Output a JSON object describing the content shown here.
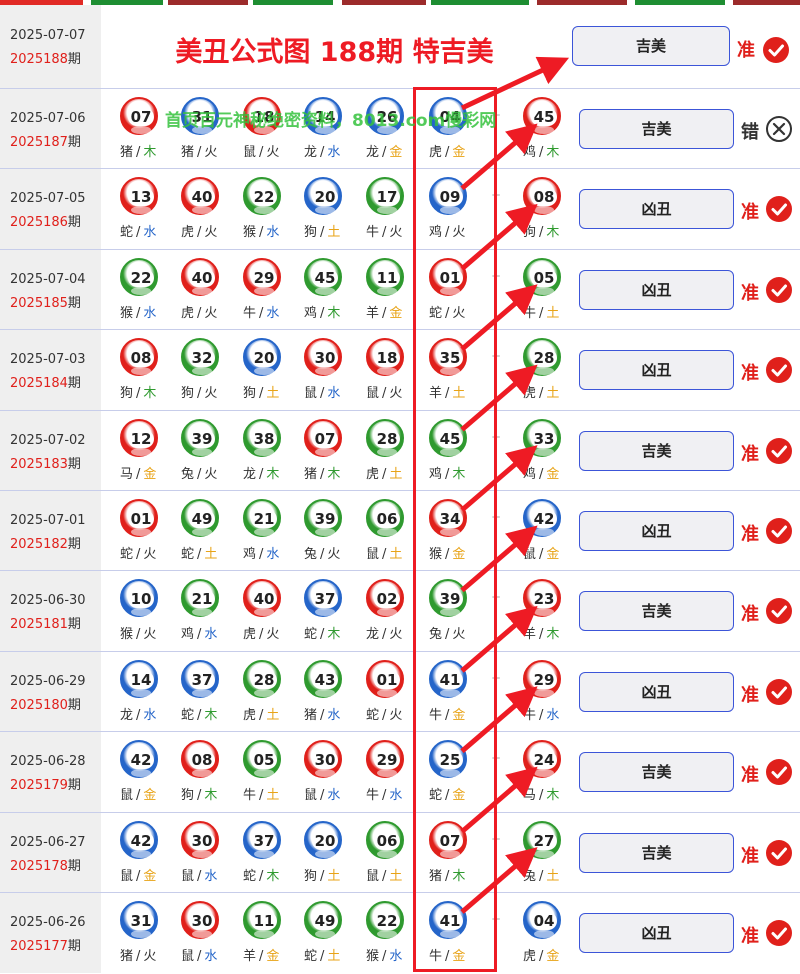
{
  "header": {
    "title": "美丑公式图 188期 特吉美",
    "result": "吉美",
    "verdict": "准"
  },
  "watermark": "首页百元神秘绝密资料，8013.com慢彩网",
  "top_stripe_colors": [
    "#e12a25",
    "#1e8e32",
    "#9c2b2b",
    "#1e8e32",
    "#9c2b2b",
    "#1e8e32",
    "#9c2b2b",
    "#1e8e32",
    "#9c2b2b",
    "#1e8e32",
    "#2a4ad6"
  ],
  "latest": {
    "date": "2025-07-07",
    "issue": "2025188",
    "suffix": "期"
  },
  "rows": [
    {
      "date": "2025-07-06",
      "issue": "2025187",
      "suffix": "期",
      "balls": [
        {
          "n": "07",
          "c": "red",
          "z": "猪",
          "e": "木"
        },
        {
          "n": "31",
          "c": "blue",
          "z": "猪",
          "e": "火"
        },
        {
          "n": "18",
          "c": "red",
          "z": "鼠",
          "e": "火"
        },
        {
          "n": "14",
          "c": "blue",
          "z": "龙",
          "e": "水"
        },
        {
          "n": "26",
          "c": "blue",
          "z": "龙",
          "e": "金"
        },
        {
          "n": "04",
          "c": "blue",
          "z": "虎",
          "e": "金"
        },
        {
          "n": "45",
          "c": "red",
          "z": "鸡",
          "e": "木"
        }
      ],
      "result": "吉美",
      "verdict": "错",
      "ok": false
    },
    {
      "date": "2025-07-05",
      "issue": "2025186",
      "suffix": "期",
      "balls": [
        {
          "n": "13",
          "c": "red",
          "z": "蛇",
          "e": "水"
        },
        {
          "n": "40",
          "c": "red",
          "z": "虎",
          "e": "火"
        },
        {
          "n": "22",
          "c": "green",
          "z": "猴",
          "e": "水"
        },
        {
          "n": "20",
          "c": "blue",
          "z": "狗",
          "e": "土"
        },
        {
          "n": "17",
          "c": "green",
          "z": "牛",
          "e": "火"
        },
        {
          "n": "09",
          "c": "blue",
          "z": "鸡",
          "e": "火"
        },
        {
          "n": "08",
          "c": "red",
          "z": "狗",
          "e": "木"
        }
      ],
      "result": "凶丑",
      "verdict": "准",
      "ok": true
    },
    {
      "date": "2025-07-04",
      "issue": "2025185",
      "suffix": "期",
      "balls": [
        {
          "n": "22",
          "c": "green",
          "z": "猴",
          "e": "水"
        },
        {
          "n": "40",
          "c": "red",
          "z": "虎",
          "e": "火"
        },
        {
          "n": "29",
          "c": "red",
          "z": "牛",
          "e": "水"
        },
        {
          "n": "45",
          "c": "green",
          "z": "鸡",
          "e": "木"
        },
        {
          "n": "11",
          "c": "green",
          "z": "羊",
          "e": "金"
        },
        {
          "n": "01",
          "c": "red",
          "z": "蛇",
          "e": "火"
        },
        {
          "n": "05",
          "c": "green",
          "z": "牛",
          "e": "土"
        }
      ],
      "result": "凶丑",
      "verdict": "准",
      "ok": true
    },
    {
      "date": "2025-07-03",
      "issue": "2025184",
      "suffix": "期",
      "balls": [
        {
          "n": "08",
          "c": "red",
          "z": "狗",
          "e": "木"
        },
        {
          "n": "32",
          "c": "green",
          "z": "狗",
          "e": "火"
        },
        {
          "n": "20",
          "c": "blue",
          "z": "狗",
          "e": "土"
        },
        {
          "n": "30",
          "c": "red",
          "z": "鼠",
          "e": "水"
        },
        {
          "n": "18",
          "c": "red",
          "z": "鼠",
          "e": "火"
        },
        {
          "n": "35",
          "c": "red",
          "z": "羊",
          "e": "土"
        },
        {
          "n": "28",
          "c": "green",
          "z": "虎",
          "e": "土"
        }
      ],
      "result": "凶丑",
      "verdict": "准",
      "ok": true
    },
    {
      "date": "2025-07-02",
      "issue": "2025183",
      "suffix": "期",
      "balls": [
        {
          "n": "12",
          "c": "red",
          "z": "马",
          "e": "金"
        },
        {
          "n": "39",
          "c": "green",
          "z": "兔",
          "e": "火"
        },
        {
          "n": "38",
          "c": "green",
          "z": "龙",
          "e": "木"
        },
        {
          "n": "07",
          "c": "red",
          "z": "猪",
          "e": "木"
        },
        {
          "n": "28",
          "c": "green",
          "z": "虎",
          "e": "土"
        },
        {
          "n": "45",
          "c": "green",
          "z": "鸡",
          "e": "木"
        },
        {
          "n": "33",
          "c": "green",
          "z": "鸡",
          "e": "金"
        }
      ],
      "result": "吉美",
      "verdict": "准",
      "ok": true
    },
    {
      "date": "2025-07-01",
      "issue": "2025182",
      "suffix": "期",
      "balls": [
        {
          "n": "01",
          "c": "red",
          "z": "蛇",
          "e": "火"
        },
        {
          "n": "49",
          "c": "green",
          "z": "蛇",
          "e": "土"
        },
        {
          "n": "21",
          "c": "green",
          "z": "鸡",
          "e": "水"
        },
        {
          "n": "39",
          "c": "green",
          "z": "兔",
          "e": "火"
        },
        {
          "n": "06",
          "c": "green",
          "z": "鼠",
          "e": "土"
        },
        {
          "n": "34",
          "c": "red",
          "z": "猴",
          "e": "金"
        },
        {
          "n": "42",
          "c": "blue",
          "z": "鼠",
          "e": "金"
        }
      ],
      "result": "凶丑",
      "verdict": "准",
      "ok": true
    },
    {
      "date": "2025-06-30",
      "issue": "2025181",
      "suffix": "期",
      "balls": [
        {
          "n": "10",
          "c": "blue",
          "z": "猴",
          "e": "火"
        },
        {
          "n": "21",
          "c": "green",
          "z": "鸡",
          "e": "水"
        },
        {
          "n": "40",
          "c": "red",
          "z": "虎",
          "e": "火"
        },
        {
          "n": "37",
          "c": "blue",
          "z": "蛇",
          "e": "木"
        },
        {
          "n": "02",
          "c": "red",
          "z": "龙",
          "e": "火"
        },
        {
          "n": "39",
          "c": "green",
          "z": "兔",
          "e": "火"
        },
        {
          "n": "23",
          "c": "red",
          "z": "羊",
          "e": "木"
        }
      ],
      "result": "吉美",
      "verdict": "准",
      "ok": true
    },
    {
      "date": "2025-06-29",
      "issue": "2025180",
      "suffix": "期",
      "balls": [
        {
          "n": "14",
          "c": "blue",
          "z": "龙",
          "e": "水"
        },
        {
          "n": "37",
          "c": "blue",
          "z": "蛇",
          "e": "木"
        },
        {
          "n": "28",
          "c": "green",
          "z": "虎",
          "e": "土"
        },
        {
          "n": "43",
          "c": "green",
          "z": "猪",
          "e": "水"
        },
        {
          "n": "01",
          "c": "red",
          "z": "蛇",
          "e": "火"
        },
        {
          "n": "41",
          "c": "blue",
          "z": "牛",
          "e": "金"
        },
        {
          "n": "29",
          "c": "red",
          "z": "牛",
          "e": "水"
        }
      ],
      "result": "凶丑",
      "verdict": "准",
      "ok": true
    },
    {
      "date": "2025-06-28",
      "issue": "2025179",
      "suffix": "期",
      "balls": [
        {
          "n": "42",
          "c": "blue",
          "z": "鼠",
          "e": "金"
        },
        {
          "n": "08",
          "c": "red",
          "z": "狗",
          "e": "木"
        },
        {
          "n": "05",
          "c": "green",
          "z": "牛",
          "e": "土"
        },
        {
          "n": "30",
          "c": "red",
          "z": "鼠",
          "e": "水"
        },
        {
          "n": "29",
          "c": "red",
          "z": "牛",
          "e": "水"
        },
        {
          "n": "25",
          "c": "blue",
          "z": "蛇",
          "e": "金"
        },
        {
          "n": "24",
          "c": "red",
          "z": "马",
          "e": "木"
        }
      ],
      "result": "吉美",
      "verdict": "准",
      "ok": true
    },
    {
      "date": "2025-06-27",
      "issue": "2025178",
      "suffix": "期",
      "balls": [
        {
          "n": "42",
          "c": "blue",
          "z": "鼠",
          "e": "金"
        },
        {
          "n": "30",
          "c": "red",
          "z": "鼠",
          "e": "水"
        },
        {
          "n": "37",
          "c": "blue",
          "z": "蛇",
          "e": "木"
        },
        {
          "n": "20",
          "c": "blue",
          "z": "狗",
          "e": "土"
        },
        {
          "n": "06",
          "c": "green",
          "z": "鼠",
          "e": "土"
        },
        {
          "n": "07",
          "c": "red",
          "z": "猪",
          "e": "木"
        },
        {
          "n": "27",
          "c": "green",
          "z": "兔",
          "e": "土"
        }
      ],
      "result": "吉美",
      "verdict": "准",
      "ok": true
    },
    {
      "date": "2025-06-26",
      "issue": "2025177",
      "suffix": "期",
      "balls": [
        {
          "n": "31",
          "c": "blue",
          "z": "猪",
          "e": "火"
        },
        {
          "n": "30",
          "c": "red",
          "z": "鼠",
          "e": "水"
        },
        {
          "n": "11",
          "c": "green",
          "z": "羊",
          "e": "金"
        },
        {
          "n": "49",
          "c": "green",
          "z": "蛇",
          "e": "土"
        },
        {
          "n": "22",
          "c": "green",
          "z": "猴",
          "e": "水"
        },
        {
          "n": "41",
          "c": "blue",
          "z": "牛",
          "e": "金"
        },
        {
          "n": "04",
          "c": "blue",
          "z": "虎",
          "e": "金"
        }
      ],
      "result": "凶丑",
      "verdict": "准",
      "ok": true
    }
  ],
  "plus_sign": "+",
  "slash": "/",
  "ball_colors": {
    "red": "#e0201b",
    "blue": "#2565c9",
    "green": "#2f9a2f"
  },
  "element_colors": {
    "金": "#e8a317",
    "木": "#2f9a2f",
    "水": "#2565c9",
    "火": "#333333",
    "土": "#e8a317"
  },
  "verdict_colors": {
    "ok": "#e0201b",
    "bad": "#333333"
  }
}
